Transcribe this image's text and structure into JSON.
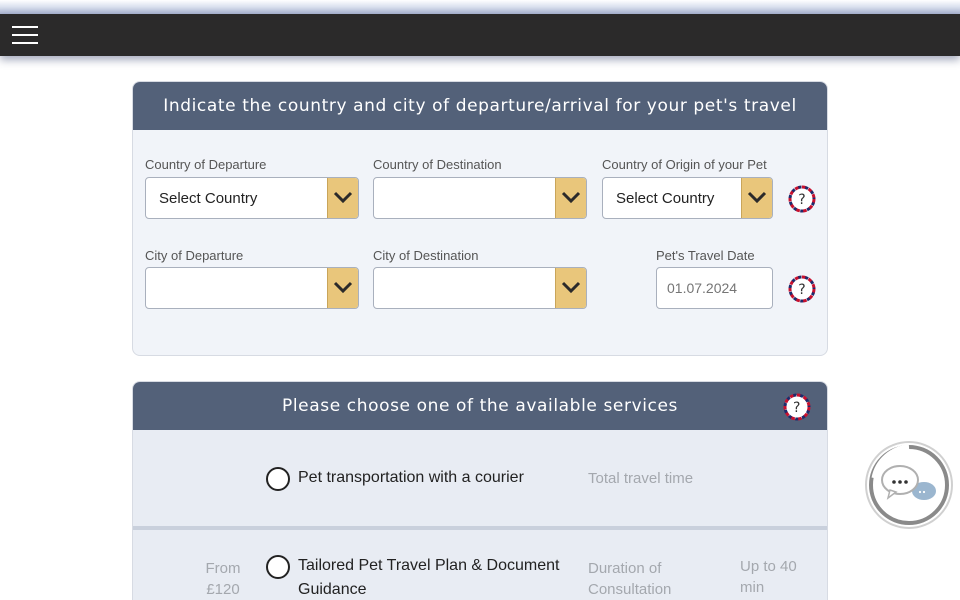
{
  "nav": {
    "menu_icon": "hamburger-menu-icon"
  },
  "route_panel": {
    "title": "Indicate the country and city of departure/arrival for your pet's travel",
    "departure_country": {
      "label": "Country of Departure",
      "value": "Select Country"
    },
    "destination_country": {
      "label": "Country of Destination",
      "value": ""
    },
    "origin_country": {
      "label": "Country of Origin of your Pet",
      "value": "Select Country"
    },
    "departure_city": {
      "label": "City of Departure",
      "value": ""
    },
    "destination_city": {
      "label": "City of Destination",
      "value": ""
    },
    "travel_date": {
      "label": "Pet's Travel Date",
      "value": "01.07.2024"
    },
    "help_icon": "help-question-icon"
  },
  "services_panel": {
    "title": "Please choose one of the available services",
    "services": [
      {
        "label": "Pet transportation with a courier",
        "info_label": "Total travel time",
        "price": "",
        "info_value": ""
      },
      {
        "price": "From £120",
        "label": "Tailored Pet Travel Plan & Document Guidance",
        "info_label": "Duration of Consultation",
        "info_value": "Up to 40 min"
      }
    ]
  },
  "chat": {
    "icon": "chat-bubbles-icon"
  },
  "colors": {
    "header": "#536179",
    "dropdown_accent": "#e9c67b",
    "navbar": "#2b2a2a"
  }
}
